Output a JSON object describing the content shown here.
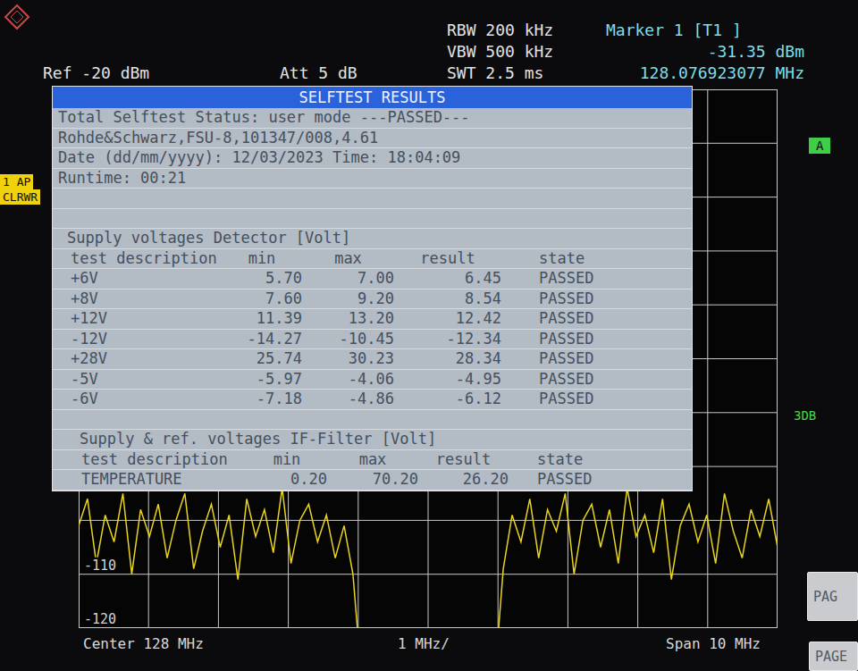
{
  "header": {
    "ref_level": "Ref -20 dBm",
    "attenuation": "Att 5 dB",
    "rbw": "RBW 200 kHz",
    "vbw": "VBW 500 kHz",
    "sweep_time": "SWT 2.5 ms"
  },
  "marker": {
    "label": "Marker 1 [T1 ]",
    "reading": "-31.35 dBm",
    "frequency": "128.076923077 MHz"
  },
  "trace_labels": [
    "1 AP",
    "CLRWR"
  ],
  "right_labels": {
    "display_line": "A",
    "mode": "3DB"
  },
  "chart": {
    "y_ticks": [
      "-110",
      "-120"
    ],
    "trace": {
      "values": [
        -101,
        -96,
        -108,
        -99,
        -104,
        -95,
        -110,
        -98,
        -103,
        -97,
        -107,
        -100,
        -95,
        -109,
        -102,
        -97,
        -105,
        -99,
        -111,
        -96,
        -103,
        -98,
        -106,
        -94,
        -108,
        -100,
        -97,
        -104,
        -99,
        -107,
        -101,
        -110,
        -130,
        -130,
        -130,
        -130,
        -130,
        -130,
        -130,
        -130,
        -130,
        -130,
        -130,
        -130,
        -130,
        -130,
        -130,
        -130,
        -109,
        -99,
        -104,
        -96,
        -107,
        -98,
        -102,
        -95,
        -110,
        -100,
        -97,
        -105,
        -98,
        -108,
        -94,
        -103,
        -99,
        -106,
        -96,
        -111,
        -101,
        -97,
        -104,
        -99,
        -108,
        -95,
        -102,
        -107,
        -98,
        -103,
        -96,
        -105
      ]
    }
  },
  "dialog": {
    "title": "SELFTEST RESULTS",
    "info_lines": [
      "Total Selftest Status: user mode ---PASSED---",
      "Rohde&Schwarz,FSU-8,101347/008,4.61",
      "Date (dd/mm/yyyy): 12/03/2023 Time: 18:04:09",
      "Runtime: 00:21"
    ],
    "sections": [
      {
        "title": "Supply voltages Detector [Volt]",
        "columns": [
          "test description",
          "min",
          "max",
          "result",
          "state"
        ],
        "rows": [
          {
            "test": "+6V",
            "min": "5.70",
            "max": "7.00",
            "result": "6.45",
            "state": "PASSED"
          },
          {
            "test": "+8V",
            "min": "7.60",
            "max": "9.20",
            "result": "8.54",
            "state": "PASSED"
          },
          {
            "test": "+12V",
            "min": "11.39",
            "max": "13.20",
            "result": "12.42",
            "state": "PASSED"
          },
          {
            "test": "-12V",
            "min": "-14.27",
            "max": "-10.45",
            "result": "-12.34",
            "state": "PASSED"
          },
          {
            "test": "+28V",
            "min": "25.74",
            "max": "30.23",
            "result": "28.34",
            "state": "PASSED"
          },
          {
            "test": "-5V",
            "min": "-5.97",
            "max": "-4.06",
            "result": "-4.95",
            "state": "PASSED"
          },
          {
            "test": "-6V",
            "min": "-7.18",
            "max": "-4.86",
            "result": "-6.12",
            "state": "PASSED"
          }
        ]
      },
      {
        "title": "Supply & ref. voltages IF-Filter [Volt]",
        "columns": [
          "test description",
          "min",
          "max",
          "result",
          "state"
        ],
        "rows": [
          {
            "test": "TEMPERATURE",
            "min": "0.20",
            "max": "70.20",
            "result": "26.20",
            "state": "PASSED"
          }
        ]
      }
    ]
  },
  "footer": {
    "center": "Center 128 MHz",
    "scale": "1 MHz/",
    "span": "Span 10 MHz"
  },
  "softkeys": [
    {
      "label": "PAG"
    },
    {
      "label": "PAGE"
    }
  ]
}
